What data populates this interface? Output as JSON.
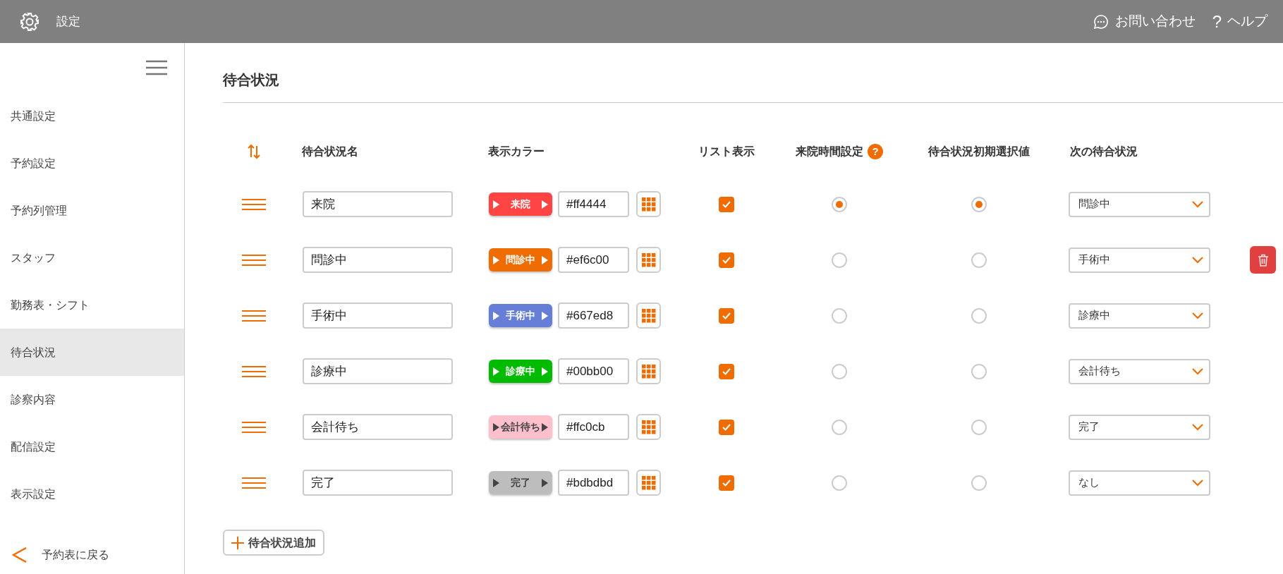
{
  "header": {
    "title": "設定",
    "contact": "お問い合わせ",
    "help_icon": "?",
    "help": "ヘルプ"
  },
  "sidebar": {
    "items": [
      {
        "label": "共通設定",
        "selected": false
      },
      {
        "label": "予約設定",
        "selected": false
      },
      {
        "label": "予約列管理",
        "selected": false
      },
      {
        "label": "スタッフ",
        "selected": false
      },
      {
        "label": "勤務表・シフト",
        "selected": false
      },
      {
        "label": "待合状況",
        "selected": true
      },
      {
        "label": "診察内容",
        "selected": false
      },
      {
        "label": "配信設定",
        "selected": false
      },
      {
        "label": "表示設定",
        "selected": false
      }
    ],
    "back": "予約表に戻る"
  },
  "page_title": "待合状況",
  "table": {
    "columns": [
      "待合状況名",
      "表示カラー",
      "リスト表示",
      "来院時間設定",
      "待合状況初期選択値",
      "次の待合状況"
    ],
    "help_badge": "?",
    "rows": [
      {
        "name": "来院",
        "chip_label": "来院",
        "color": "#ff4444",
        "hex": "#ff4444",
        "list_display": true,
        "arrival_time": true,
        "initial": true,
        "next": "問診中",
        "deletable": false
      },
      {
        "name": "問診中",
        "chip_label": "問診中",
        "color": "#ef6c00",
        "hex": "#ef6c00",
        "list_display": true,
        "arrival_time": false,
        "initial": false,
        "next": "手術中",
        "deletable": true
      },
      {
        "name": "手術中",
        "chip_label": "手術中",
        "color": "#667ed8",
        "hex": "#667ed8",
        "list_display": true,
        "arrival_time": false,
        "initial": false,
        "next": "診療中",
        "deletable": false
      },
      {
        "name": "診療中",
        "chip_label": "診療中",
        "color": "#00bb00",
        "hex": "#00bb00",
        "list_display": true,
        "arrival_time": false,
        "initial": false,
        "next": "会計待ち",
        "deletable": false
      },
      {
        "name": "会計待ち",
        "chip_label": "会計待ち",
        "color": "#ffc0cb",
        "hex": "#ffc0cb",
        "list_display": true,
        "arrival_time": false,
        "initial": false,
        "next": "完了",
        "deletable": false
      },
      {
        "name": "完了",
        "chip_label": "完了",
        "color": "#bdbdbd",
        "hex": "#bdbdbd",
        "list_display": true,
        "arrival_time": false,
        "initial": false,
        "next": "なし",
        "deletable": false
      }
    ]
  },
  "add_button": "待合状況追加"
}
